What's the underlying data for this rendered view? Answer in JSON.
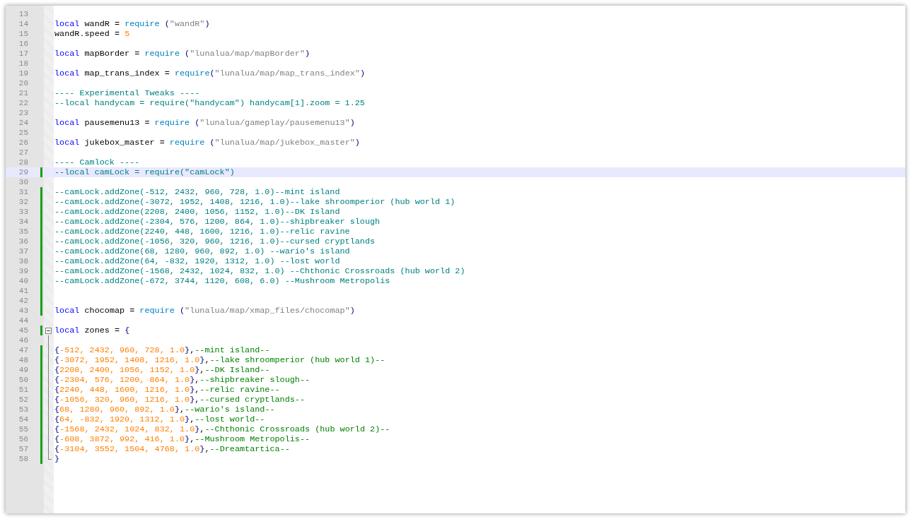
{
  "editor": {
    "lines": [
      {
        "number": "13",
        "changed": false,
        "current": false
      },
      {
        "number": "14",
        "changed": false,
        "current": false,
        "tokens": [
          {
            "kind": "keyword",
            "text": "local"
          },
          {
            "kind": "plain",
            "text": " wandR = "
          },
          {
            "kind": "builtin",
            "text": "require"
          },
          {
            "kind": "op",
            "text": " ("
          },
          {
            "kind": "string",
            "text": "\"wandR\""
          },
          {
            "kind": "op",
            "text": ")"
          }
        ]
      },
      {
        "number": "15",
        "changed": false,
        "current": false,
        "tokens": [
          {
            "kind": "plain",
            "text": "wandR.speed = "
          },
          {
            "kind": "number",
            "text": "5"
          }
        ]
      },
      {
        "number": "16",
        "changed": false,
        "current": false
      },
      {
        "number": "17",
        "changed": false,
        "current": false,
        "tokens": [
          {
            "kind": "keyword",
            "text": "local"
          },
          {
            "kind": "plain",
            "text": " mapBorder = "
          },
          {
            "kind": "builtin",
            "text": "require"
          },
          {
            "kind": "op",
            "text": " ("
          },
          {
            "kind": "string",
            "text": "\"lunalua/map/mapBorder\""
          },
          {
            "kind": "op",
            "text": ")"
          }
        ]
      },
      {
        "number": "18",
        "changed": false,
        "current": false
      },
      {
        "number": "19",
        "changed": false,
        "current": false,
        "tokens": [
          {
            "kind": "keyword",
            "text": "local"
          },
          {
            "kind": "plain",
            "text": " map_trans_index = "
          },
          {
            "kind": "builtin",
            "text": "require"
          },
          {
            "kind": "op",
            "text": "("
          },
          {
            "kind": "string",
            "text": "\"lunalua/map/map_trans_index\""
          },
          {
            "kind": "op",
            "text": ")"
          }
        ]
      },
      {
        "number": "20",
        "changed": false,
        "current": false
      },
      {
        "number": "21",
        "changed": false,
        "current": false,
        "tokens": [
          {
            "kind": "comment",
            "text": "---- Experimental Tweaks ----"
          }
        ]
      },
      {
        "number": "22",
        "changed": false,
        "current": false,
        "tokens": [
          {
            "kind": "comment",
            "text": "--local handycam = require(\"handycam\") handycam[1].zoom = 1.25"
          }
        ]
      },
      {
        "number": "23",
        "changed": false,
        "current": false
      },
      {
        "number": "24",
        "changed": false,
        "current": false,
        "tokens": [
          {
            "kind": "keyword",
            "text": "local"
          },
          {
            "kind": "plain",
            "text": " pausemenu13 = "
          },
          {
            "kind": "builtin",
            "text": "require"
          },
          {
            "kind": "op",
            "text": " ("
          },
          {
            "kind": "string",
            "text": "\"lunalua/gameplay/pausemenu13\""
          },
          {
            "kind": "op",
            "text": ")"
          }
        ]
      },
      {
        "number": "25",
        "changed": false,
        "current": false
      },
      {
        "number": "26",
        "changed": false,
        "current": false,
        "tokens": [
          {
            "kind": "keyword",
            "text": "local"
          },
          {
            "kind": "plain",
            "text": " jukebox_master = "
          },
          {
            "kind": "builtin",
            "text": "require"
          },
          {
            "kind": "op",
            "text": " ("
          },
          {
            "kind": "string",
            "text": "\"lunalua/map/jukebox_master\""
          },
          {
            "kind": "op",
            "text": ")"
          }
        ]
      },
      {
        "number": "27",
        "changed": false,
        "current": false
      },
      {
        "number": "28",
        "changed": false,
        "current": false,
        "tokens": [
          {
            "kind": "comment",
            "text": "---- Camlock ----"
          }
        ]
      },
      {
        "number": "29",
        "changed": true,
        "current": true,
        "tokens": [
          {
            "kind": "comment",
            "text": "--local camLock = require(\"camLock\")"
          }
        ]
      },
      {
        "number": "30",
        "changed": false,
        "current": false
      },
      {
        "number": "31",
        "changed": true,
        "current": false,
        "tokens": [
          {
            "kind": "comment",
            "text": "--camLock.addZone(-512, 2432, 960, 728, 1.0)--mint island"
          }
        ]
      },
      {
        "number": "32",
        "changed": true,
        "current": false,
        "tokens": [
          {
            "kind": "comment",
            "text": "--camLock.addZone(-3072, 1952, 1408, 1216, 1.0)--lake shroomperior (hub world 1)"
          }
        ]
      },
      {
        "number": "33",
        "changed": true,
        "current": false,
        "tokens": [
          {
            "kind": "comment",
            "text": "--camLock.addZone(2208, 2400, 1056, 1152, 1.0)--DK Island"
          }
        ]
      },
      {
        "number": "34",
        "changed": true,
        "current": false,
        "tokens": [
          {
            "kind": "comment",
            "text": "--camLock.addZone(-2304, 576, 1200, 864, 1.0)--shipbreaker slough"
          }
        ]
      },
      {
        "number": "35",
        "changed": true,
        "current": false,
        "tokens": [
          {
            "kind": "comment",
            "text": "--camLock.addZone(2240, 448, 1600, 1216, 1.0)--relic ravine"
          }
        ]
      },
      {
        "number": "36",
        "changed": true,
        "current": false,
        "tokens": [
          {
            "kind": "comment",
            "text": "--camLock.addZone(-1056, 320, 960, 1216, 1.0)--cursed cryptlands"
          }
        ]
      },
      {
        "number": "37",
        "changed": true,
        "current": false,
        "tokens": [
          {
            "kind": "comment",
            "text": "--camLock.addZone(68, 1280, 960, 892, 1.0) --wario's island"
          }
        ]
      },
      {
        "number": "38",
        "changed": true,
        "current": false,
        "tokens": [
          {
            "kind": "comment",
            "text": "--camLock.addZone(64, -832, 1920, 1312, 1.0) --lost world"
          }
        ]
      },
      {
        "number": "39",
        "changed": true,
        "current": false,
        "tokens": [
          {
            "kind": "comment",
            "text": "--camLock.addZone(-1568, 2432, 1024, 832, 1.0) --Chthonic Crossroads (hub world 2)"
          }
        ]
      },
      {
        "number": "40",
        "changed": true,
        "current": false,
        "tokens": [
          {
            "kind": "comment",
            "text": "--camLock.addZone(-672, 3744, 1120, 608, 6.0) --Mushroom Metropolis"
          }
        ]
      },
      {
        "number": "41",
        "changed": true,
        "current": false
      },
      {
        "number": "42",
        "changed": true,
        "current": false
      },
      {
        "number": "43",
        "changed": true,
        "current": false,
        "tokens": [
          {
            "kind": "keyword",
            "text": "local"
          },
          {
            "kind": "plain",
            "text": " chocomap = "
          },
          {
            "kind": "builtin",
            "text": "require"
          },
          {
            "kind": "op",
            "text": " ("
          },
          {
            "kind": "string",
            "text": "\"lunalua/map/xmap_files/chocomap\""
          },
          {
            "kind": "op",
            "text": ")"
          }
        ]
      },
      {
        "number": "44",
        "changed": false,
        "current": false
      },
      {
        "number": "45",
        "changed": true,
        "current": false,
        "kind": "foldstart",
        "tokens": [
          {
            "kind": "keyword",
            "text": "local"
          },
          {
            "kind": "plain",
            "text": " zones = "
          },
          {
            "kind": "op",
            "text": "{"
          }
        ]
      },
      {
        "number": "46",
        "changed": false,
        "current": false,
        "kind": "foldbody"
      },
      {
        "number": "47",
        "changed": true,
        "current": false,
        "kind": "foldbody",
        "tokens": [
          {
            "kind": "op",
            "text": "{"
          },
          {
            "kind": "number",
            "text": "-512, 2432, 960, 728, 1.0"
          },
          {
            "kind": "op",
            "text": "}"
          },
          {
            "kind": "plain",
            "text": ","
          },
          {
            "kind": "note",
            "text": "--mint island--"
          }
        ]
      },
      {
        "number": "48",
        "changed": true,
        "current": false,
        "kind": "foldbody",
        "tokens": [
          {
            "kind": "op",
            "text": "{"
          },
          {
            "kind": "number",
            "text": "-3072, 1952, 1408, 1216, 1.0"
          },
          {
            "kind": "op",
            "text": "}"
          },
          {
            "kind": "plain",
            "text": ","
          },
          {
            "kind": "note",
            "text": "--lake shroomperior (hub world 1)--"
          }
        ]
      },
      {
        "number": "49",
        "changed": true,
        "current": false,
        "kind": "foldbody",
        "tokens": [
          {
            "kind": "op",
            "text": "{"
          },
          {
            "kind": "number",
            "text": "2208, 2400, 1056, 1152, 1.0"
          },
          {
            "kind": "op",
            "text": "}"
          },
          {
            "kind": "plain",
            "text": ","
          },
          {
            "kind": "note",
            "text": "--DK Island--"
          }
        ]
      },
      {
        "number": "50",
        "changed": true,
        "current": false,
        "kind": "foldbody",
        "tokens": [
          {
            "kind": "op",
            "text": "{"
          },
          {
            "kind": "number",
            "text": "-2304, 576, 1200, 864, 1.0"
          },
          {
            "kind": "op",
            "text": "}"
          },
          {
            "kind": "plain",
            "text": ","
          },
          {
            "kind": "note",
            "text": "--shipbreaker slough--"
          }
        ]
      },
      {
        "number": "51",
        "changed": true,
        "current": false,
        "kind": "foldbody",
        "tokens": [
          {
            "kind": "op",
            "text": "{"
          },
          {
            "kind": "number",
            "text": "2240, 448, 1600, 1216, 1.0"
          },
          {
            "kind": "op",
            "text": "}"
          },
          {
            "kind": "plain",
            "text": ","
          },
          {
            "kind": "note",
            "text": "--relic ravine--"
          }
        ]
      },
      {
        "number": "52",
        "changed": true,
        "current": false,
        "kind": "foldbody",
        "tokens": [
          {
            "kind": "op",
            "text": "{"
          },
          {
            "kind": "number",
            "text": "-1056, 320, 960, 1216, 1.0"
          },
          {
            "kind": "op",
            "text": "}"
          },
          {
            "kind": "plain",
            "text": ","
          },
          {
            "kind": "note",
            "text": "--cursed cryptlands--"
          }
        ]
      },
      {
        "number": "53",
        "changed": true,
        "current": false,
        "kind": "foldbody",
        "tokens": [
          {
            "kind": "op",
            "text": "{"
          },
          {
            "kind": "number",
            "text": "68, 1280, 960, 892, 1.0"
          },
          {
            "kind": "op",
            "text": "}"
          },
          {
            "kind": "plain",
            "text": ","
          },
          {
            "kind": "note",
            "text": "--wario's island--"
          }
        ]
      },
      {
        "number": "54",
        "changed": true,
        "current": false,
        "kind": "foldbody",
        "tokens": [
          {
            "kind": "op",
            "text": "{"
          },
          {
            "kind": "number",
            "text": "64, -832, 1920, 1312, 1.0"
          },
          {
            "kind": "op",
            "text": "}"
          },
          {
            "kind": "plain",
            "text": ","
          },
          {
            "kind": "note",
            "text": "--lost world--"
          }
        ]
      },
      {
        "number": "55",
        "changed": true,
        "current": false,
        "kind": "foldbody",
        "tokens": [
          {
            "kind": "op",
            "text": "{"
          },
          {
            "kind": "number",
            "text": "-1568, 2432, 1024, 832, 1.0"
          },
          {
            "kind": "op",
            "text": "}"
          },
          {
            "kind": "plain",
            "text": ","
          },
          {
            "kind": "note",
            "text": "--Chthonic Crossroads (hub world 2)--"
          }
        ]
      },
      {
        "number": "56",
        "changed": true,
        "current": false,
        "kind": "foldbody",
        "tokens": [
          {
            "kind": "op",
            "text": "{"
          },
          {
            "kind": "number",
            "text": "-608, 3872, 992, 416, 1.0"
          },
          {
            "kind": "op",
            "text": "}"
          },
          {
            "kind": "plain",
            "text": ","
          },
          {
            "kind": "note",
            "text": "--Mushroom Metropolis--"
          }
        ]
      },
      {
        "number": "57",
        "changed": true,
        "current": false,
        "kind": "foldbody",
        "tokens": [
          {
            "kind": "op",
            "text": "{"
          },
          {
            "kind": "number",
            "text": "-3104, 3552, 1504, 4768, 1.0"
          },
          {
            "kind": "op",
            "text": "}"
          },
          {
            "kind": "plain",
            "text": ","
          },
          {
            "kind": "note",
            "text": "--Dreamtartica--"
          }
        ]
      },
      {
        "number": "58",
        "changed": true,
        "current": false,
        "kind": "foldend",
        "tokens": [
          {
            "kind": "op",
            "text": "}"
          }
        ]
      }
    ]
  }
}
